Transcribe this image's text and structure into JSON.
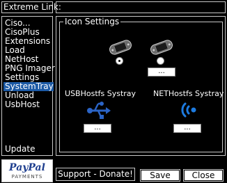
{
  "header": {
    "title": "Extreme Link:"
  },
  "sidebar": {
    "items": [
      {
        "label": "Ciso..."
      },
      {
        "label": "CisoPlus"
      },
      {
        "label": "Extensions"
      },
      {
        "label": "Load"
      },
      {
        "label": "NetHost"
      },
      {
        "label": "PNG Imager"
      },
      {
        "label": "Settings"
      },
      {
        "label": "SystemTray"
      },
      {
        "label": "Unload"
      },
      {
        "label": "UsbHost"
      }
    ],
    "selected": "SystemTray",
    "bottom_item": "Update"
  },
  "panel": {
    "group_title": "Icon Settings",
    "usb_label": "USBHostfs Systray",
    "net_label": "NETHostfs Systray",
    "browse_label": "...",
    "radio_left_selected": true
  },
  "footer": {
    "paypal_text": "PayPal",
    "payments_text": "PAYMENTS",
    "support_label": "Support - Donate!",
    "save_label": "Save",
    "close_label": "Close"
  },
  "colors": {
    "selection": "#1c5aa6",
    "usb_icon": "#2b64c6",
    "net_icon": "#1d7be0",
    "paypal_dark": "#1f3f8f",
    "paypal_light": "#2c9ce0"
  },
  "icons": [
    "psp-device-icon",
    "usb-icon",
    "wireless-signal-icon"
  ]
}
